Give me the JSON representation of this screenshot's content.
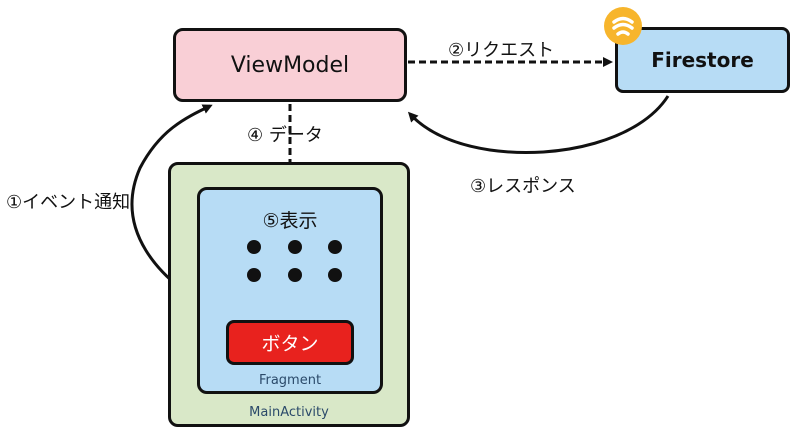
{
  "nodes": {
    "viewmodel": "ViewModel",
    "firestore": "Firestore",
    "main_activity": "MainActivity",
    "fragment": "Fragment",
    "display": "⑤表示",
    "button": "ボタン"
  },
  "edges": {
    "request": "②リクエスト",
    "response": "③レスポンス",
    "data": "④ データ",
    "event": "①イベント通知"
  },
  "colors": {
    "viewmodel_fill": "#f9cfd6",
    "firestore_fill": "#b7dcf5",
    "activity_fill": "#d9e8c8",
    "fragment_fill": "#b7dcf5",
    "button_fill": "#e8221e",
    "firebase_badge": "#f7b52c"
  },
  "icons": {
    "firebase": "firebase-icon"
  }
}
